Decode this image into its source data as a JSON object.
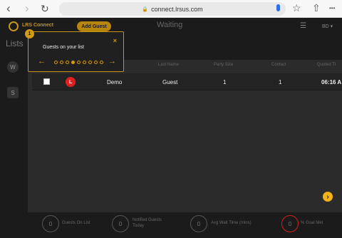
{
  "browser": {
    "url": "connect.lrsus.com",
    "back": "‹",
    "forward": "›",
    "reload": "↻",
    "star": "☆",
    "share": "⇧",
    "more": "•••",
    "lock": "🔒"
  },
  "header": {
    "brand": "LRS Connect",
    "add_guest": "Add Guest",
    "title": "Waiting",
    "menu": "☰",
    "user": "BD ▾"
  },
  "sidebar": {
    "title": "Lists",
    "items": [
      "W",
      "S"
    ]
  },
  "table": {
    "headers": [
      "Last Name",
      "Party Size",
      "Contact",
      "Quoted Ti"
    ],
    "row": {
      "status": "L",
      "first_name": "Demo",
      "last_name": "Guest",
      "party_size": "1",
      "contact": "1",
      "quoted_time": "06:16 A"
    }
  },
  "popover": {
    "step": "1",
    "title": "Guests on your list",
    "close": "×",
    "prev": "←",
    "next": "→",
    "dots": 9,
    "active_dot": 3
  },
  "scroll_button": "›",
  "stats": [
    {
      "value": "0",
      "label": "Guests On List"
    },
    {
      "value": "0",
      "label": "Notified Guests Today"
    },
    {
      "value": "0",
      "label": "Avg Wait Time (mins)"
    },
    {
      "value": "0",
      "label": "% Goal Met"
    }
  ]
}
